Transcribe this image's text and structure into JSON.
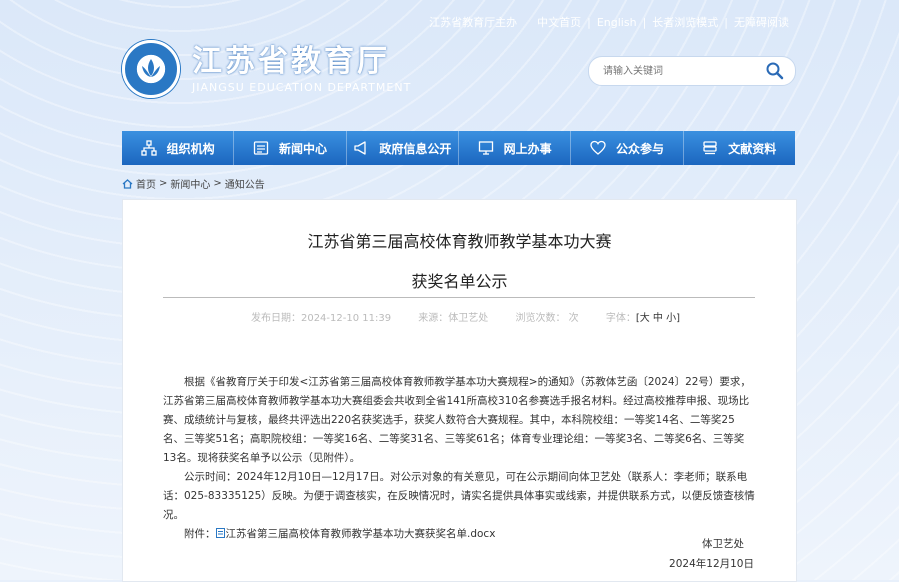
{
  "topbar": {
    "sponsor": "江苏省教育厅主办",
    "home": "中文首页",
    "english": "English",
    "elder": "长者浏览模式",
    "accessible": "无障碍阅读"
  },
  "logo": {
    "cn": "江苏省教育厅",
    "en": "JIANGSU EDUCATION DEPARTMENT"
  },
  "search": {
    "placeholder": "请输入关键词"
  },
  "nav": {
    "items": [
      {
        "label": "组织机构",
        "icon": "org-chart-icon"
      },
      {
        "label": "新闻中心",
        "icon": "newspaper-icon"
      },
      {
        "label": "政府信息公开",
        "icon": "megaphone-icon"
      },
      {
        "label": "网上办事",
        "icon": "monitor-icon"
      },
      {
        "label": "公众参与",
        "icon": "heart-icon"
      },
      {
        "label": "文献资料",
        "icon": "books-icon"
      }
    ]
  },
  "breadcrumb": {
    "home": "首页",
    "news": "新闻中心",
    "notices": "通知公告",
    "sep": ">"
  },
  "article": {
    "title_line1": "江苏省第三届高校体育教师教学基本功大赛",
    "title_line2": "获奖名单公示",
    "meta": {
      "date": "发布日期：2024-12-10 11:39",
      "source": "来源：体卫艺处",
      "views": "浏览次数： 次",
      "font_label": "字体：",
      "font_sizes": "[大 中 小]"
    },
    "para1": "根据《省教育厅关于印发<江苏省第三届高校体育教师教学基本功大赛规程>的通知》（苏教体艺函〔2024〕22号）要求，江苏省第三届高校体育教师教学基本功大赛组委会共收到全省141所高校310名参赛选手报名材料。经过高校推荐申报、现场比赛、成绩统计与复核，最终共评选出220名获奖选手，获奖人数符合大赛规程。其中，本科院校组：一等奖14名、二等奖25名、三等奖51名；高职院校组：一等奖16名、二等奖31名、三等奖61名；体育专业理论组：一等奖3名、二等奖6名、三等奖13名。现将获奖名单予以公示（见附件）。",
    "para2": "公示时间：2024年12月10日—12月17日。对公示对象的有关意见，可在公示期间向体卫艺处（联系人：李老师；联系电话：025-83335125）反映。为便于调查核实，在反映情况时，请实名提供具体事实或线索，并提供联系方式，以便反馈查核情况。",
    "attachment_label": "附件：",
    "attachment_file": "江苏省第三届高校体育教师教学基本功大赛获奖名单.docx",
    "signature": "体卫艺处",
    "sign_date": "2024年12月10日"
  },
  "colors": {
    "nav_top": "#3a90e0",
    "nav_bottom": "#1b66bf",
    "accent": "#2a78c4"
  }
}
